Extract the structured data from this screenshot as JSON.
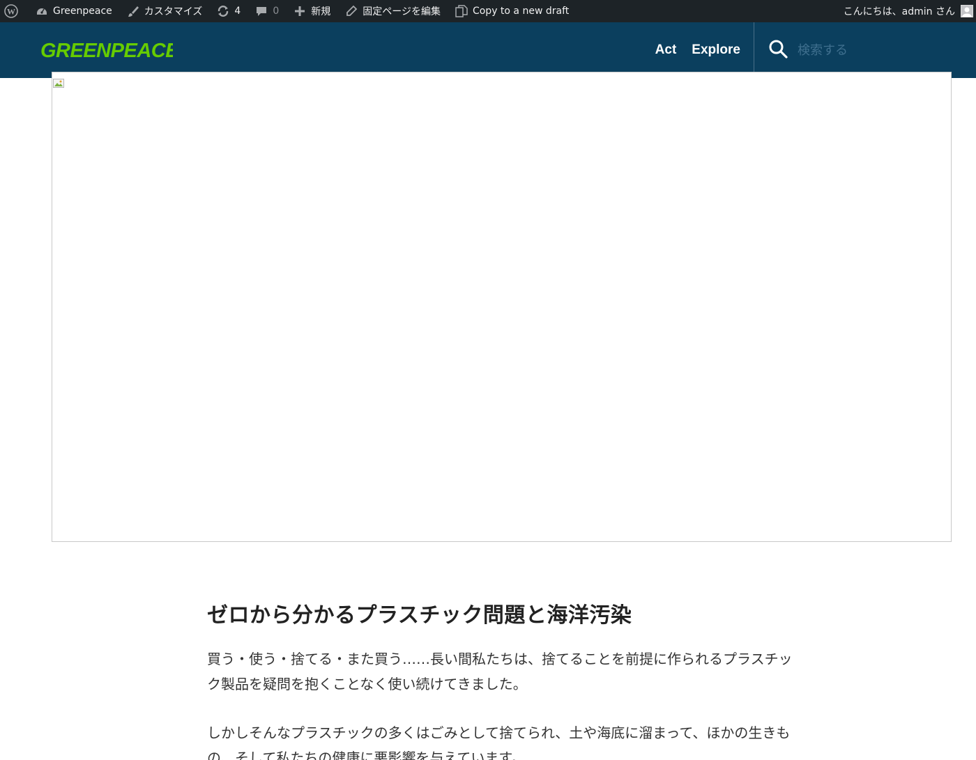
{
  "admin_bar": {
    "site_name": "Greenpeace",
    "customize_label": "カスタマイズ",
    "updates_count": "4",
    "comments_count": "0",
    "new_label": "新規",
    "edit_page_label": "固定ページを編集",
    "copy_draft_label": "Copy to a new draft",
    "greeting": "こんにちは、admin さん"
  },
  "header": {
    "logo_text": "GREENPEACE",
    "nav": [
      {
        "label": "Act"
      },
      {
        "label": "Explore"
      }
    ],
    "search_placeholder": "検索する"
  },
  "article": {
    "title": "ゼロから分かるプラスチック問題と海洋汚染",
    "paragraphs": [
      "買う・使う・捨てる・また買う……長い間私たちは、捨てることを前提に作られるプラスチック製品を疑問を抱くことなく使い続けてきました。",
      "しかしそんなプラスチックの多くはごみとして捨てられ、土や海底に溜まって、ほかの生きもの、そして私たちの健康に悪影響を与えています。"
    ]
  },
  "colors": {
    "admin_bar_bg": "#1d2327",
    "header_bg": "#0b3f5e",
    "logo_green": "#66cc00"
  },
  "icons": [
    "wordpress-icon",
    "dashboard-icon",
    "brush-icon",
    "updates-icon",
    "comment-icon",
    "plus-icon",
    "pencil-icon",
    "copy-icon",
    "search-icon",
    "avatar-icon",
    "broken-image-icon"
  ]
}
